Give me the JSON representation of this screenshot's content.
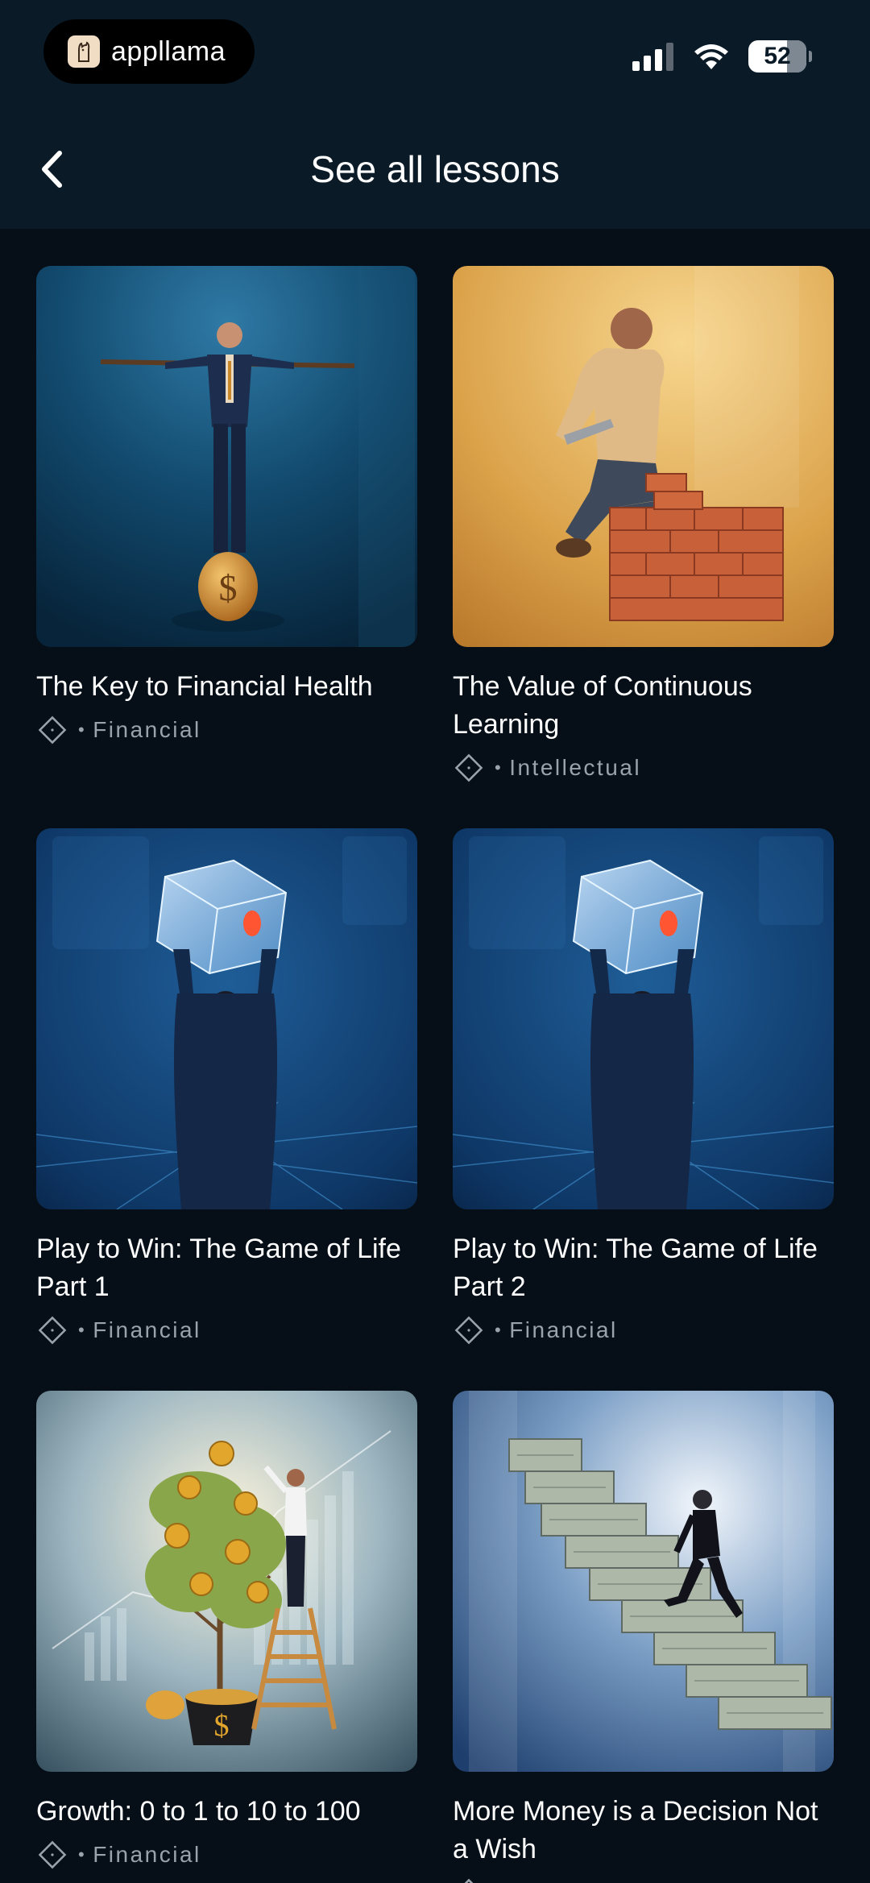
{
  "status_bar": {
    "app_name": "appllama",
    "battery": "52"
  },
  "nav": {
    "title": "See all lessons"
  },
  "lessons": [
    {
      "title": "The Key to Financial Health",
      "category": "Financial"
    },
    {
      "title": "The Value of Continuous Learning",
      "category": "Intellectual"
    },
    {
      "title": "Play to Win: The Game of Life Part 1",
      "category": "Financial"
    },
    {
      "title": "Play to Win: The Game of Life Part 2",
      "category": "Financial"
    },
    {
      "title": "Growth: 0 to 1 to 10 to 100",
      "category": "Financial"
    },
    {
      "title": "More Money is a Decision Not a Wish",
      "category": ""
    }
  ],
  "icons": {
    "back": "chevron-left-icon",
    "category": "diamond-icon",
    "signal": "cellular-signal-icon",
    "wifi": "wifi-icon",
    "battery": "battery-icon",
    "logo": "llama-logo-icon"
  }
}
